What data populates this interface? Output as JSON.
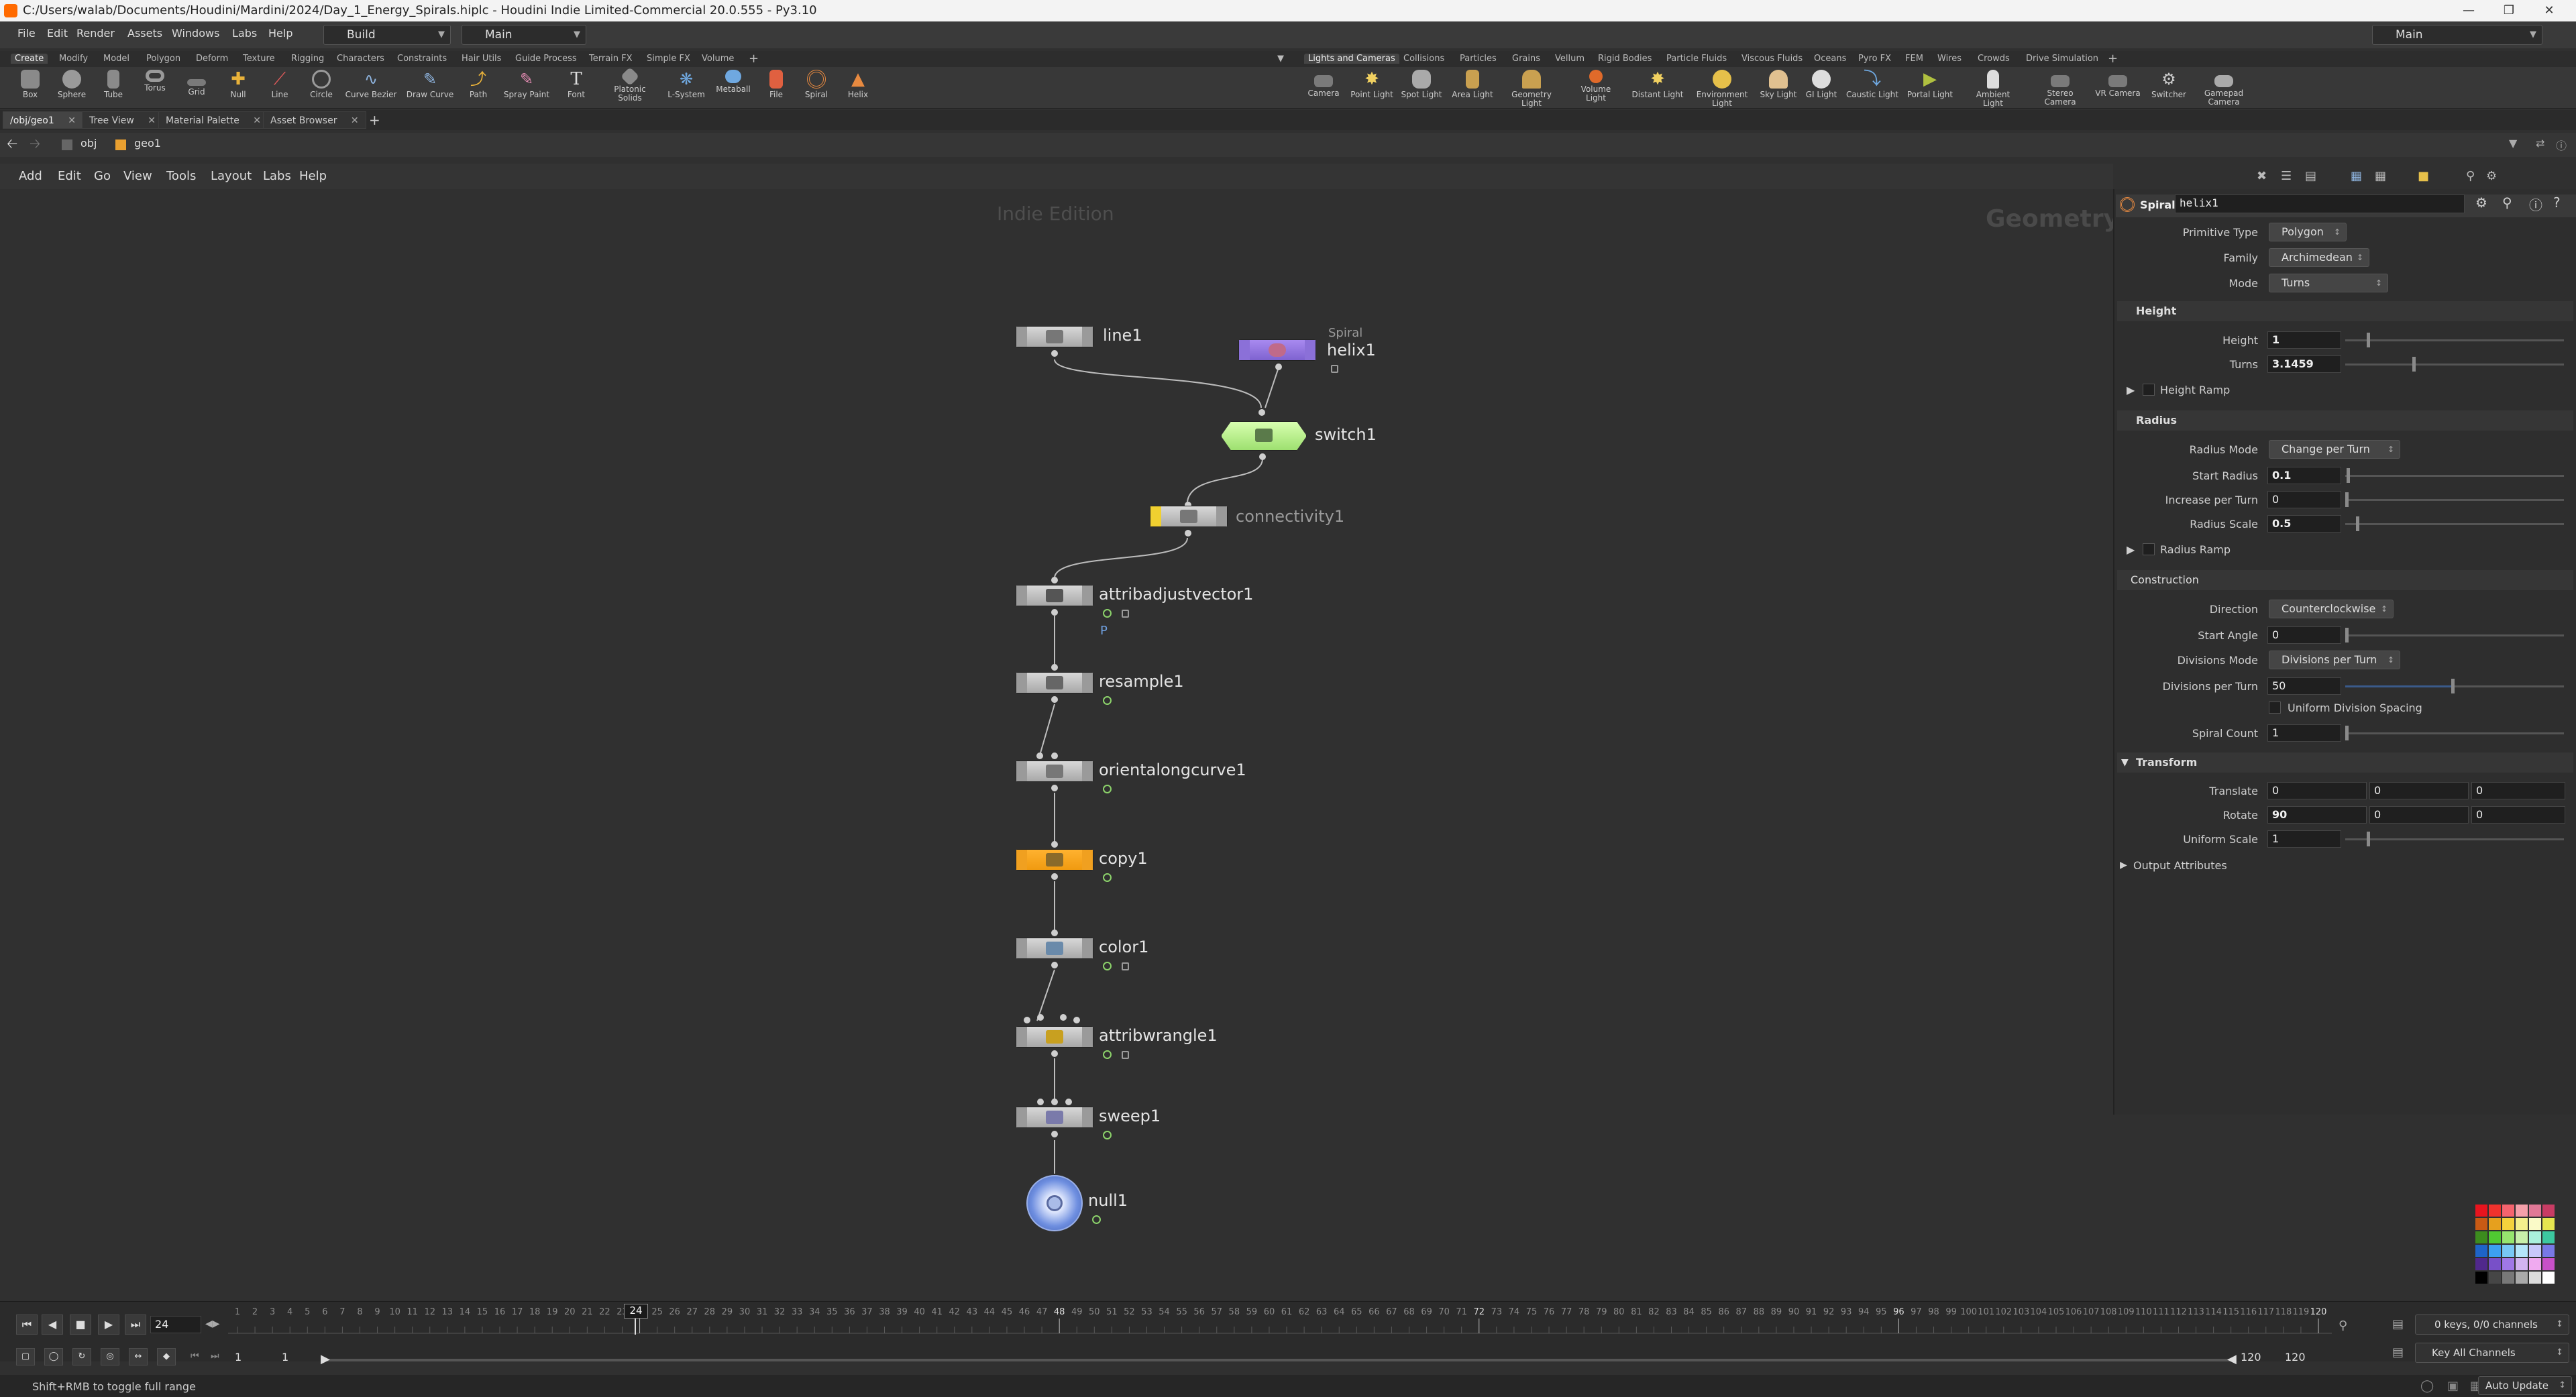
{
  "titlebar": {
    "title": "C:/Users/walab/Documents/Houdini/Mardini/2024/Day_1_Energy_Spirals.hiplc - Houdini Indie Limited-Commercial 20.0.555 - Py3.10"
  },
  "menubar": {
    "items": [
      "File",
      "Edit",
      "Render",
      "Assets",
      "Windows",
      "Labs",
      "Help"
    ],
    "desktop": "Build",
    "runner": "Main",
    "right_desktop": "Main"
  },
  "shelf_left": {
    "tabs": [
      "Create",
      "Modify",
      "Model",
      "Polygon",
      "Deform",
      "Texture",
      "Rigging",
      "Characters",
      "Constraints",
      "Hair Utils",
      "Guide Process",
      "Terrain FX",
      "Simple FX",
      "Volume"
    ],
    "tools": [
      "Box",
      "Sphere",
      "Tube",
      "Torus",
      "Grid",
      "Null",
      "Line",
      "Circle",
      "Curve Bezier",
      "Draw Curve",
      "Path",
      "Spray Paint",
      "Font",
      "Platonic Solids",
      "L-System",
      "Metaball",
      "File",
      "Spiral",
      "Helix"
    ]
  },
  "shelf_right": {
    "tabs": [
      "Lights and Cameras",
      "Collisions",
      "Particles",
      "Grains",
      "Vellum",
      "Rigid Bodies",
      "Particle Fluids",
      "Viscous Fluids",
      "Oceans",
      "Pyro FX",
      "FEM",
      "Wires",
      "Crowds",
      "Drive Simulation"
    ],
    "tools": [
      "Camera",
      "Point Light",
      "Spot Light",
      "Area Light",
      "Geometry Light",
      "Volume Light",
      "Distant Light",
      "Environment Light",
      "Sky Light",
      "GI Light",
      "Caustic Light",
      "Portal Light",
      "Ambient Light",
      "Stereo Camera",
      "VR Camera",
      "Switcher",
      "Gamepad Camera"
    ]
  },
  "pane_tabs": [
    "/obj/geo1",
    "Tree View",
    "Material Palette",
    "Asset Browser"
  ],
  "path": {
    "root": "obj",
    "current": "geo1"
  },
  "network_menu": [
    "Add",
    "Edit",
    "Go",
    "View",
    "Tools",
    "Layout",
    "Labs",
    "Help"
  ],
  "network": {
    "watermark_left": "Indie Edition",
    "watermark_right": "Geometry",
    "nodes": [
      {
        "name": "line1"
      },
      {
        "name": "helix1",
        "type_label": "Spiral"
      },
      {
        "name": "switch1"
      },
      {
        "name": "connectivity1"
      },
      {
        "name": "attribadjustvector1",
        "attr_label": "P"
      },
      {
        "name": "resample1"
      },
      {
        "name": "orientalongcurve1"
      },
      {
        "name": "copy1"
      },
      {
        "name": "color1"
      },
      {
        "name": "attribwrangle1"
      },
      {
        "name": "sweep1"
      },
      {
        "name": "null1"
      }
    ]
  },
  "params": {
    "node_type": "Spiral",
    "node_name": "helix1",
    "primitive_type": {
      "label": "Primitive Type",
      "value": "Polygon"
    },
    "family": {
      "label": "Family",
      "value": "Archimedean"
    },
    "mode": {
      "label": "Mode",
      "value": "Turns"
    },
    "height_section": "Height",
    "height": {
      "label": "Height",
      "value": "1"
    },
    "turns": {
      "label": "Turns",
      "value": "3.1459"
    },
    "height_ramp": "Height Ramp",
    "radius_section": "Radius",
    "radius_mode": {
      "label": "Radius Mode",
      "value": "Change per Turn"
    },
    "start_radius": {
      "label": "Start Radius",
      "value": "0.1"
    },
    "increase_per_turn": {
      "label": "Increase per Turn",
      "value": "0"
    },
    "radius_scale": {
      "label": "Radius Scale",
      "value": "0.5"
    },
    "radius_ramp": "Radius Ramp",
    "construction_section": "Construction",
    "direction": {
      "label": "Direction",
      "value": "Counterclockwise"
    },
    "start_angle": {
      "label": "Start Angle",
      "value": "0"
    },
    "divisions_mode": {
      "label": "Divisions Mode",
      "value": "Divisions per Turn"
    },
    "divisions_per_turn": {
      "label": "Divisions per Turn",
      "value": "50"
    },
    "uniform_division": "Uniform Division Spacing",
    "spiral_count": {
      "label": "Spiral Count",
      "value": "1"
    },
    "transform_section": "Transform",
    "translate": {
      "label": "Translate",
      "x": "0",
      "y": "0",
      "z": "0"
    },
    "rotate": {
      "label": "Rotate",
      "x": "90",
      "y": "0",
      "z": "0"
    },
    "uniform_scale": {
      "label": "Uniform Scale",
      "value": "1"
    },
    "output_attributes": "Output Attributes"
  },
  "timeline": {
    "current_frame": "24",
    "ruler_labels": [
      "1",
      "2",
      "3",
      "4",
      "5",
      "6",
      "7",
      "8",
      "9",
      "10",
      "11",
      "12",
      "13",
      "14",
      "15",
      "16",
      "17",
      "18",
      "19",
      "20",
      "21",
      "22",
      "23",
      "24",
      "25",
      "26",
      "27",
      "28",
      "29",
      "30",
      "31",
      "32",
      "33",
      "34",
      "35",
      "36",
      "37",
      "38",
      "39",
      "40",
      "41",
      "42",
      "43",
      "44",
      "45",
      "46",
      "47",
      "48",
      "49",
      "50",
      "51",
      "52",
      "53",
      "54",
      "55",
      "56",
      "57",
      "58",
      "59",
      "60",
      "61",
      "62",
      "63",
      "64",
      "65",
      "66",
      "67",
      "68",
      "69",
      "70",
      "71",
      "72",
      "73",
      "74",
      "75",
      "76",
      "77",
      "78",
      "79",
      "80",
      "81",
      "82",
      "83",
      "84",
      "85",
      "86",
      "87",
      "88",
      "89",
      "90",
      "91",
      "92",
      "93",
      "94",
      "95",
      "96",
      "97",
      "98",
      "99",
      "100",
      "101",
      "102",
      "103",
      "104",
      "105",
      "106",
      "107",
      "108",
      "109",
      "110",
      "111",
      "112",
      "113",
      "114",
      "115",
      "116",
      "117",
      "118",
      "119",
      "120"
    ],
    "start_a": "1",
    "start_b": "1",
    "end_a": "120",
    "end_b": "120",
    "keys_info": "0 keys, 0/0 channels",
    "key_all": "Key All Channels"
  },
  "status": {
    "hint": "Shift+RMB to toggle full range",
    "auto_update": "Auto Update"
  },
  "palette_colors": [
    "#e8141e",
    "#f0322d",
    "#f5646e",
    "#f5a0aa",
    "#e07896",
    "#c83c64",
    "#c85a14",
    "#e6a01e",
    "#f5d23c",
    "#f5f08c",
    "#fafac8",
    "#e6e650",
    "#3c8c1e",
    "#50c832",
    "#96e66e",
    "#c8f0aa",
    "#aaf0dc",
    "#3cc8a0",
    "#1e64c8",
    "#3ca0f0",
    "#78c8f5",
    "#b4e6fa",
    "#c8c8fa",
    "#7878e6",
    "#50288c",
    "#7850c8",
    "#a078e6",
    "#d2b4f0",
    "#f0aaf0",
    "#c850c8",
    "#000000",
    "#464646",
    "#787878",
    "#aaaaaa",
    "#dcdcdc",
    "#ffffff"
  ]
}
